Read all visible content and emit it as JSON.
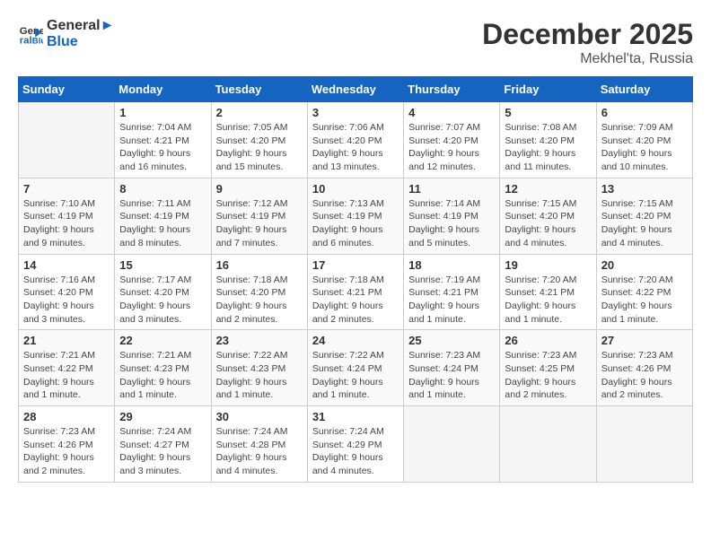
{
  "logo": {
    "line1": "General",
    "line2": "Blue"
  },
  "header": {
    "month": "December 2025",
    "location": "Mekhel'ta, Russia"
  },
  "weekdays": [
    "Sunday",
    "Monday",
    "Tuesday",
    "Wednesday",
    "Thursday",
    "Friday",
    "Saturday"
  ],
  "weeks": [
    [
      {
        "day": "",
        "info": ""
      },
      {
        "day": "1",
        "info": "Sunrise: 7:04 AM\nSunset: 4:21 PM\nDaylight: 9 hours\nand 16 minutes."
      },
      {
        "day": "2",
        "info": "Sunrise: 7:05 AM\nSunset: 4:20 PM\nDaylight: 9 hours\nand 15 minutes."
      },
      {
        "day": "3",
        "info": "Sunrise: 7:06 AM\nSunset: 4:20 PM\nDaylight: 9 hours\nand 13 minutes."
      },
      {
        "day": "4",
        "info": "Sunrise: 7:07 AM\nSunset: 4:20 PM\nDaylight: 9 hours\nand 12 minutes."
      },
      {
        "day": "5",
        "info": "Sunrise: 7:08 AM\nSunset: 4:20 PM\nDaylight: 9 hours\nand 11 minutes."
      },
      {
        "day": "6",
        "info": "Sunrise: 7:09 AM\nSunset: 4:20 PM\nDaylight: 9 hours\nand 10 minutes."
      }
    ],
    [
      {
        "day": "7",
        "info": "Sunrise: 7:10 AM\nSunset: 4:19 PM\nDaylight: 9 hours\nand 9 minutes."
      },
      {
        "day": "8",
        "info": "Sunrise: 7:11 AM\nSunset: 4:19 PM\nDaylight: 9 hours\nand 8 minutes."
      },
      {
        "day": "9",
        "info": "Sunrise: 7:12 AM\nSunset: 4:19 PM\nDaylight: 9 hours\nand 7 minutes."
      },
      {
        "day": "10",
        "info": "Sunrise: 7:13 AM\nSunset: 4:19 PM\nDaylight: 9 hours\nand 6 minutes."
      },
      {
        "day": "11",
        "info": "Sunrise: 7:14 AM\nSunset: 4:19 PM\nDaylight: 9 hours\nand 5 minutes."
      },
      {
        "day": "12",
        "info": "Sunrise: 7:15 AM\nSunset: 4:20 PM\nDaylight: 9 hours\nand 4 minutes."
      },
      {
        "day": "13",
        "info": "Sunrise: 7:15 AM\nSunset: 4:20 PM\nDaylight: 9 hours\nand 4 minutes."
      }
    ],
    [
      {
        "day": "14",
        "info": "Sunrise: 7:16 AM\nSunset: 4:20 PM\nDaylight: 9 hours\nand 3 minutes."
      },
      {
        "day": "15",
        "info": "Sunrise: 7:17 AM\nSunset: 4:20 PM\nDaylight: 9 hours\nand 3 minutes."
      },
      {
        "day": "16",
        "info": "Sunrise: 7:18 AM\nSunset: 4:20 PM\nDaylight: 9 hours\nand 2 minutes."
      },
      {
        "day": "17",
        "info": "Sunrise: 7:18 AM\nSunset: 4:21 PM\nDaylight: 9 hours\nand 2 minutes."
      },
      {
        "day": "18",
        "info": "Sunrise: 7:19 AM\nSunset: 4:21 PM\nDaylight: 9 hours\nand 1 minute."
      },
      {
        "day": "19",
        "info": "Sunrise: 7:20 AM\nSunset: 4:21 PM\nDaylight: 9 hours\nand 1 minute."
      },
      {
        "day": "20",
        "info": "Sunrise: 7:20 AM\nSunset: 4:22 PM\nDaylight: 9 hours\nand 1 minute."
      }
    ],
    [
      {
        "day": "21",
        "info": "Sunrise: 7:21 AM\nSunset: 4:22 PM\nDaylight: 9 hours\nand 1 minute."
      },
      {
        "day": "22",
        "info": "Sunrise: 7:21 AM\nSunset: 4:23 PM\nDaylight: 9 hours\nand 1 minute."
      },
      {
        "day": "23",
        "info": "Sunrise: 7:22 AM\nSunset: 4:23 PM\nDaylight: 9 hours\nand 1 minute."
      },
      {
        "day": "24",
        "info": "Sunrise: 7:22 AM\nSunset: 4:24 PM\nDaylight: 9 hours\nand 1 minute."
      },
      {
        "day": "25",
        "info": "Sunrise: 7:23 AM\nSunset: 4:24 PM\nDaylight: 9 hours\nand 1 minute."
      },
      {
        "day": "26",
        "info": "Sunrise: 7:23 AM\nSunset: 4:25 PM\nDaylight: 9 hours\nand 2 minutes."
      },
      {
        "day": "27",
        "info": "Sunrise: 7:23 AM\nSunset: 4:26 PM\nDaylight: 9 hours\nand 2 minutes."
      }
    ],
    [
      {
        "day": "28",
        "info": "Sunrise: 7:23 AM\nSunset: 4:26 PM\nDaylight: 9 hours\nand 2 minutes."
      },
      {
        "day": "29",
        "info": "Sunrise: 7:24 AM\nSunset: 4:27 PM\nDaylight: 9 hours\nand 3 minutes."
      },
      {
        "day": "30",
        "info": "Sunrise: 7:24 AM\nSunset: 4:28 PM\nDaylight: 9 hours\nand 4 minutes."
      },
      {
        "day": "31",
        "info": "Sunrise: 7:24 AM\nSunset: 4:29 PM\nDaylight: 9 hours\nand 4 minutes."
      },
      {
        "day": "",
        "info": ""
      },
      {
        "day": "",
        "info": ""
      },
      {
        "day": "",
        "info": ""
      }
    ]
  ]
}
